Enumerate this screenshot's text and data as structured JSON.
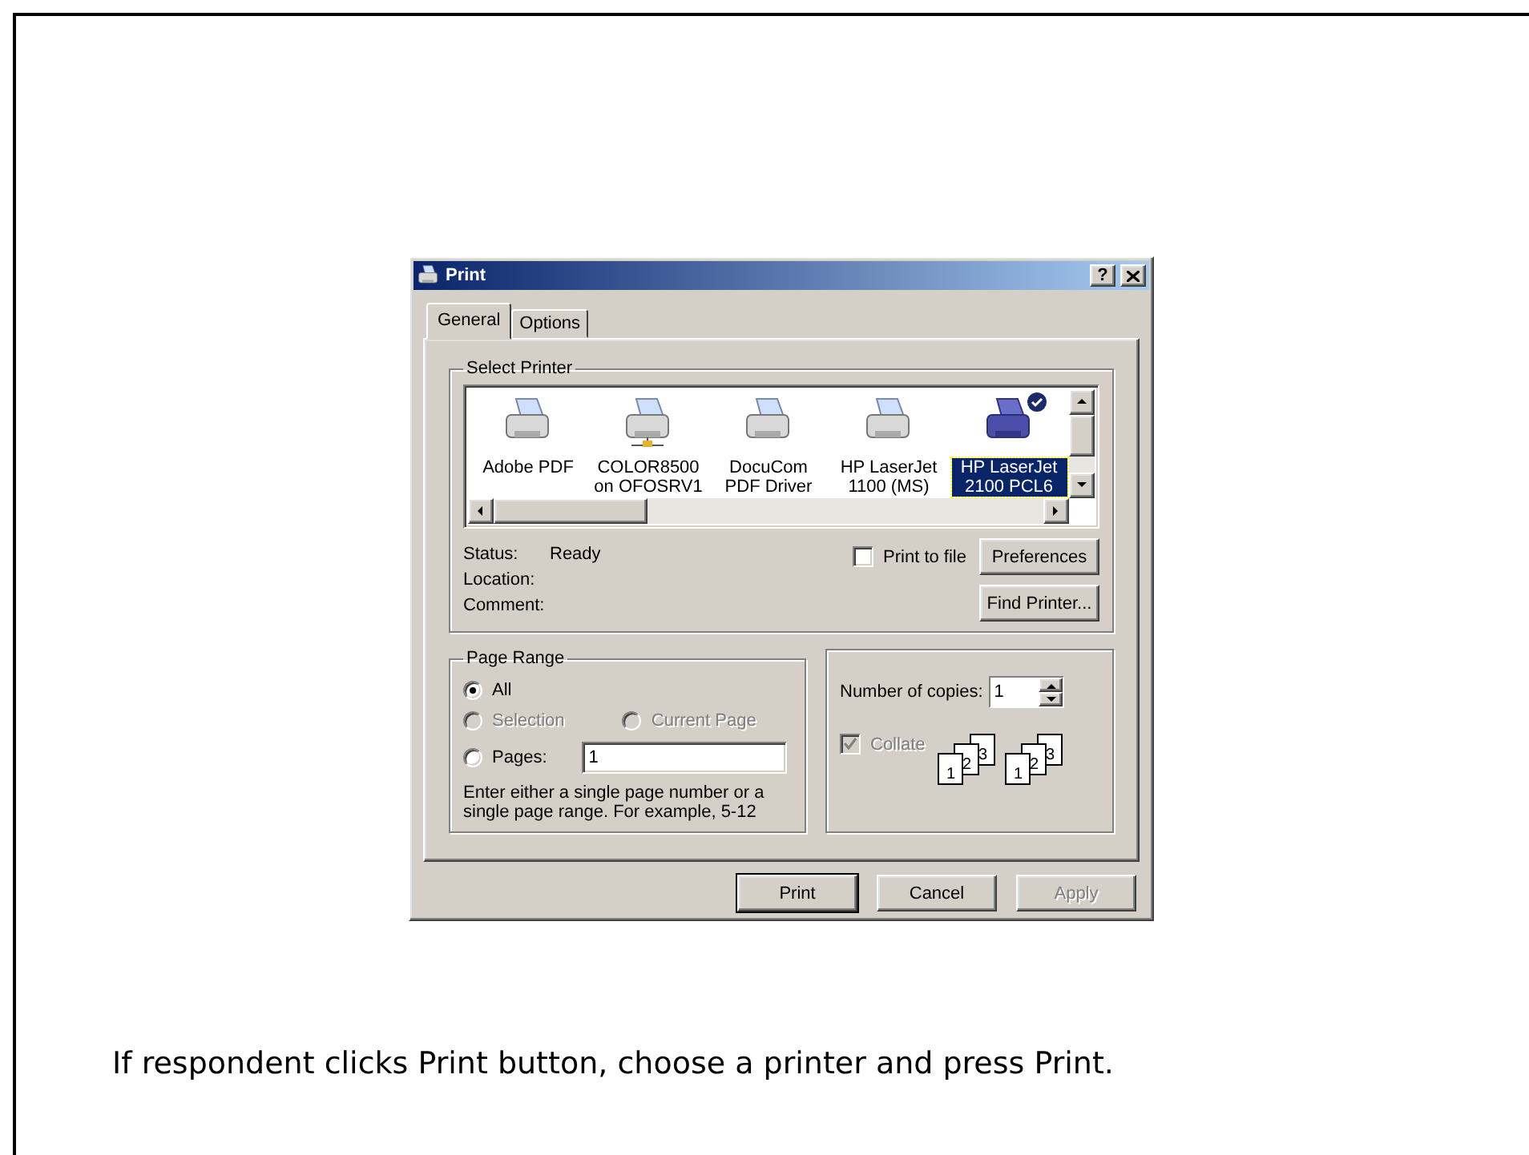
{
  "dialog": {
    "title": "Print",
    "help_button": "?",
    "tabs": [
      {
        "label": "General",
        "selected": true
      },
      {
        "label": "Options",
        "selected": false
      }
    ],
    "select_printer": {
      "label": "Select Printer",
      "printers": [
        {
          "name": "Adobe PDF",
          "kind": "local",
          "selected": false,
          "default": false
        },
        {
          "name": "COLOR8500 on OFOSRV1",
          "kind": "network",
          "selected": false,
          "default": false
        },
        {
          "name": "DocuCom PDF Driver",
          "kind": "local",
          "selected": false,
          "default": false
        },
        {
          "name": "HP LaserJet 1100 (MS)",
          "kind": "local",
          "selected": false,
          "default": false
        },
        {
          "name": "HP LaserJet 2100 PCL6",
          "kind": "local",
          "selected": true,
          "default": true
        }
      ],
      "info": [
        {
          "label": "Status:",
          "value": "Ready"
        },
        {
          "label": "Location:"
        },
        {
          "label": "Comment:"
        }
      ],
      "print_to_file": {
        "label": "Print to file",
        "checked": false
      },
      "preferences_button": "Preferences",
      "find_printer_button": "Find Printer..."
    },
    "page_range": {
      "label": "Page Range",
      "options": [
        {
          "label": "All",
          "selected": true,
          "disabled": false
        },
        {
          "label": "Selection",
          "selected": false,
          "disabled": true
        },
        {
          "label": "Current Page",
          "selected": false,
          "disabled": true
        },
        {
          "label": "Pages:",
          "selected": false,
          "disabled": false
        }
      ],
      "pages_value": "1",
      "hint": "Enter either a single page number or a single page range.  For example, 5-12"
    },
    "copies": {
      "label": "Number of copies:",
      "value": "1",
      "collate": {
        "label": "Collate",
        "checked": true,
        "disabled": true
      },
      "stacks": [
        [
          "1",
          "2",
          "3"
        ],
        [
          "1",
          "2",
          "3"
        ]
      ]
    },
    "buttons": [
      {
        "label": "Print",
        "default": true,
        "disabled": false
      },
      {
        "label": "Cancel",
        "default": false,
        "disabled": false
      },
      {
        "label": "Apply",
        "default": false,
        "disabled": true
      }
    ]
  },
  "caption": "If respondent clicks Print button, choose a printer and press Print."
}
